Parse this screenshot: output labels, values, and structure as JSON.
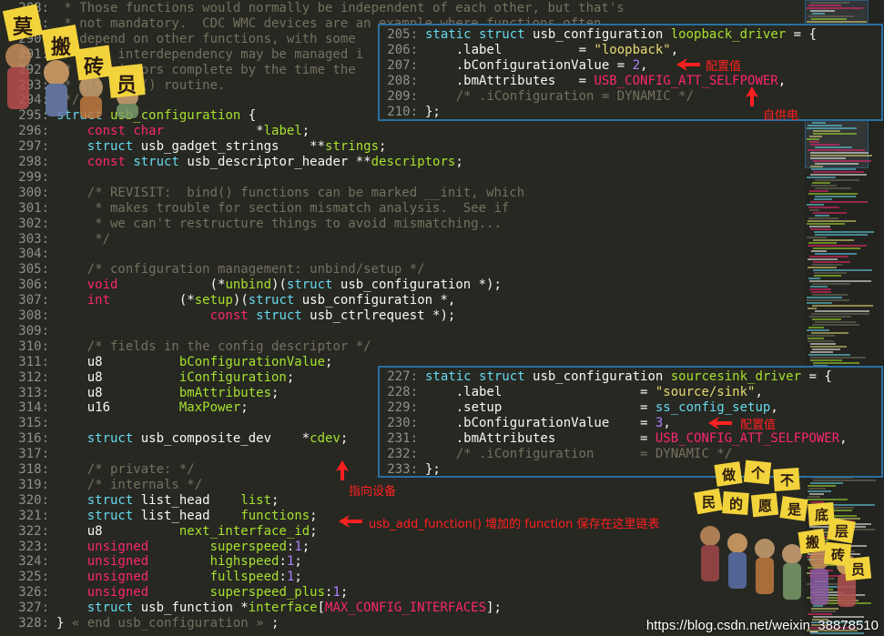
{
  "editor": {
    "lines": [
      {
        "no": "288:",
        "segs": [
          {
            "c": "cm",
            "t": " * Those functions would normally be independent of each other, but that's"
          }
        ]
      },
      {
        "no": "289:",
        "segs": [
          {
            "c": "cm",
            "t": " * not mandatory.  CDC WMC devices are an example where functions often"
          }
        ]
      },
      {
        "no": "290:",
        "segs": [
          {
            "c": "cm",
            "t": " * depend on other functions, with some"
          }
        ]
      },
      {
        "no": "291:",
        "segs": [
          {
            "c": "cm",
            "t": " * such interdependency may be managed i"
          }
        ]
      },
      {
        "no": "292:",
        "segs": [
          {
            "c": "cm",
            "t": " * descriptors complete by the time the"
          }
        ]
      },
      {
        "no": "293:",
        "segs": [
          {
            "c": "cm",
            "t": " * its bind() routine."
          }
        ]
      },
      {
        "no": "294:",
        "segs": [
          {
            "c": "cm",
            "t": " */"
          }
        ]
      },
      {
        "no": "295:",
        "segs": [
          {
            "c": "ty",
            "t": "struct"
          },
          {
            "c": "tx",
            "t": " "
          },
          {
            "c": "id",
            "t": "usb_configuration"
          },
          {
            "c": "tx",
            "t": " {"
          }
        ]
      },
      {
        "no": "296:",
        "segs": [
          {
            "c": "tx",
            "t": "    "
          },
          {
            "c": "kw",
            "t": "const"
          },
          {
            "c": "tx",
            "t": " "
          },
          {
            "c": "kw",
            "t": "char"
          },
          {
            "c": "tx",
            "t": "            *"
          },
          {
            "c": "id",
            "t": "label"
          },
          {
            "c": "tx",
            "t": ";"
          }
        ]
      },
      {
        "no": "297:",
        "segs": [
          {
            "c": "tx",
            "t": "    "
          },
          {
            "c": "ty",
            "t": "struct"
          },
          {
            "c": "tx",
            "t": " usb_gadget_strings    **"
          },
          {
            "c": "id",
            "t": "strings"
          },
          {
            "c": "tx",
            "t": ";"
          }
        ]
      },
      {
        "no": "298:",
        "segs": [
          {
            "c": "tx",
            "t": "    "
          },
          {
            "c": "kw",
            "t": "const"
          },
          {
            "c": "tx",
            "t": " "
          },
          {
            "c": "ty",
            "t": "struct"
          },
          {
            "c": "tx",
            "t": " usb_descriptor_header **"
          },
          {
            "c": "id",
            "t": "descriptors"
          },
          {
            "c": "tx",
            "t": ";"
          }
        ]
      },
      {
        "no": "299:",
        "segs": []
      },
      {
        "no": "300:",
        "segs": [
          {
            "c": "tx",
            "t": "    "
          },
          {
            "c": "cm",
            "t": "/* REVISIT:  bind() functions can be marked __init, which"
          }
        ]
      },
      {
        "no": "301:",
        "segs": [
          {
            "c": "tx",
            "t": "    "
          },
          {
            "c": "cm",
            "t": " * makes trouble for section mismatch analysis.  See if"
          }
        ]
      },
      {
        "no": "302:",
        "segs": [
          {
            "c": "tx",
            "t": "    "
          },
          {
            "c": "cm",
            "t": " * we can't restructure things to avoid mismatching..."
          }
        ]
      },
      {
        "no": "303:",
        "segs": [
          {
            "c": "tx",
            "t": "    "
          },
          {
            "c": "cm",
            "t": " */"
          }
        ]
      },
      {
        "no": "304:",
        "segs": []
      },
      {
        "no": "305:",
        "segs": [
          {
            "c": "tx",
            "t": "    "
          },
          {
            "c": "cm",
            "t": "/* configuration management: unbind/setup */"
          }
        ]
      },
      {
        "no": "306:",
        "segs": [
          {
            "c": "tx",
            "t": "    "
          },
          {
            "c": "kw",
            "t": "void"
          },
          {
            "c": "tx",
            "t": "            (*"
          },
          {
            "c": "id",
            "t": "unbind"
          },
          {
            "c": "tx",
            "t": ")("
          },
          {
            "c": "ty",
            "t": "struct"
          },
          {
            "c": "tx",
            "t": " usb_configuration *);"
          }
        ]
      },
      {
        "no": "307:",
        "segs": [
          {
            "c": "tx",
            "t": "    "
          },
          {
            "c": "kw",
            "t": "int"
          },
          {
            "c": "tx",
            "t": "         (*"
          },
          {
            "c": "id",
            "t": "setup"
          },
          {
            "c": "tx",
            "t": ")("
          },
          {
            "c": "ty",
            "t": "struct"
          },
          {
            "c": "tx",
            "t": " usb_configuration *,"
          }
        ]
      },
      {
        "no": "308:",
        "segs": [
          {
            "c": "tx",
            "t": "                    "
          },
          {
            "c": "kw",
            "t": "const"
          },
          {
            "c": "tx",
            "t": " "
          },
          {
            "c": "ty",
            "t": "struct"
          },
          {
            "c": "tx",
            "t": " usb_ctrlrequest *);"
          }
        ]
      },
      {
        "no": "309:",
        "segs": []
      },
      {
        "no": "310:",
        "segs": [
          {
            "c": "tx",
            "t": "    "
          },
          {
            "c": "cm",
            "t": "/* fields in the config descriptor */"
          }
        ]
      },
      {
        "no": "311:",
        "segs": [
          {
            "c": "tx",
            "t": "    u8          "
          },
          {
            "c": "id",
            "t": "bConfigurationValue"
          },
          {
            "c": "tx",
            "t": ";"
          }
        ]
      },
      {
        "no": "312:",
        "segs": [
          {
            "c": "tx",
            "t": "    u8          "
          },
          {
            "c": "id",
            "t": "iConfiguration"
          },
          {
            "c": "tx",
            "t": ";"
          }
        ]
      },
      {
        "no": "313:",
        "segs": [
          {
            "c": "tx",
            "t": "    u8          "
          },
          {
            "c": "id",
            "t": "bmAttributes"
          },
          {
            "c": "tx",
            "t": ";"
          }
        ]
      },
      {
        "no": "314:",
        "segs": [
          {
            "c": "tx",
            "t": "    u16         "
          },
          {
            "c": "id",
            "t": "MaxPower"
          },
          {
            "c": "tx",
            "t": ";"
          }
        ]
      },
      {
        "no": "315:",
        "segs": []
      },
      {
        "no": "316:",
        "segs": [
          {
            "c": "tx",
            "t": "    "
          },
          {
            "c": "ty",
            "t": "struct"
          },
          {
            "c": "tx",
            "t": " usb_composite_dev    *"
          },
          {
            "c": "id",
            "t": "cdev"
          },
          {
            "c": "tx",
            "t": ";"
          }
        ]
      },
      {
        "no": "317:",
        "segs": []
      },
      {
        "no": "318:",
        "segs": [
          {
            "c": "tx",
            "t": "    "
          },
          {
            "c": "cm",
            "t": "/* private: */"
          }
        ]
      },
      {
        "no": "319:",
        "segs": [
          {
            "c": "tx",
            "t": "    "
          },
          {
            "c": "cm",
            "t": "/* internals */"
          }
        ]
      },
      {
        "no": "320:",
        "segs": [
          {
            "c": "tx",
            "t": "    "
          },
          {
            "c": "ty",
            "t": "struct"
          },
          {
            "c": "tx",
            "t": " list_head    "
          },
          {
            "c": "id",
            "t": "list"
          },
          {
            "c": "tx",
            "t": ";"
          }
        ]
      },
      {
        "no": "321:",
        "segs": [
          {
            "c": "tx",
            "t": "    "
          },
          {
            "c": "ty",
            "t": "struct"
          },
          {
            "c": "tx",
            "t": " list_head    "
          },
          {
            "c": "id",
            "t": "functions"
          },
          {
            "c": "tx",
            "t": ";"
          }
        ]
      },
      {
        "no": "322:",
        "segs": [
          {
            "c": "tx",
            "t": "    u8          "
          },
          {
            "c": "id",
            "t": "next_interface_id"
          },
          {
            "c": "tx",
            "t": ";"
          }
        ]
      },
      {
        "no": "323:",
        "segs": [
          {
            "c": "tx",
            "t": "    "
          },
          {
            "c": "kw",
            "t": "unsigned"
          },
          {
            "c": "tx",
            "t": "        "
          },
          {
            "c": "id",
            "t": "superspeed"
          },
          {
            "c": "tx",
            "t": ":"
          },
          {
            "c": "nm",
            "t": "1"
          },
          {
            "c": "tx",
            "t": ";"
          }
        ]
      },
      {
        "no": "324:",
        "segs": [
          {
            "c": "tx",
            "t": "    "
          },
          {
            "c": "kw",
            "t": "unsigned"
          },
          {
            "c": "tx",
            "t": "        "
          },
          {
            "c": "id",
            "t": "highspeed"
          },
          {
            "c": "tx",
            "t": ":"
          },
          {
            "c": "nm",
            "t": "1"
          },
          {
            "c": "tx",
            "t": ";"
          }
        ]
      },
      {
        "no": "325:",
        "segs": [
          {
            "c": "tx",
            "t": "    "
          },
          {
            "c": "kw",
            "t": "unsigned"
          },
          {
            "c": "tx",
            "t": "        "
          },
          {
            "c": "id",
            "t": "fullspeed"
          },
          {
            "c": "tx",
            "t": ":"
          },
          {
            "c": "nm",
            "t": "1"
          },
          {
            "c": "tx",
            "t": ";"
          }
        ]
      },
      {
        "no": "326:",
        "segs": [
          {
            "c": "tx",
            "t": "    "
          },
          {
            "c": "kw",
            "t": "unsigned"
          },
          {
            "c": "tx",
            "t": "        "
          },
          {
            "c": "id",
            "t": "superspeed_plus"
          },
          {
            "c": "tx",
            "t": ":"
          },
          {
            "c": "nm",
            "t": "1"
          },
          {
            "c": "tx",
            "t": ";"
          }
        ]
      },
      {
        "no": "327:",
        "segs": [
          {
            "c": "tx",
            "t": "    "
          },
          {
            "c": "ty",
            "t": "struct"
          },
          {
            "c": "tx",
            "t": " usb_function *"
          },
          {
            "c": "id",
            "t": "interface"
          },
          {
            "c": "tx",
            "t": "["
          },
          {
            "c": "kw",
            "t": "MAX_CONFIG_INTERFACES"
          },
          {
            "c": "tx",
            "t": "];"
          }
        ]
      },
      {
        "no": "328:",
        "segs": [
          {
            "c": "tx",
            "t": "} "
          },
          {
            "c": "cm",
            "t": "« end usb_configuration »"
          },
          {
            "c": "tx",
            "t": " ;"
          }
        ]
      }
    ]
  },
  "popup1": {
    "lines": [
      {
        "no": "205:",
        "segs": [
          {
            "c": "ty",
            "t": "static"
          },
          {
            "c": "tx",
            "t": " "
          },
          {
            "c": "ty",
            "t": "struct"
          },
          {
            "c": "tx",
            "t": " usb_configuration "
          },
          {
            "c": "id",
            "t": "loopback_driver"
          },
          {
            "c": "tx",
            "t": " = {"
          }
        ]
      },
      {
        "no": "206:",
        "segs": [
          {
            "c": "tx",
            "t": "    .label          = "
          },
          {
            "c": "st",
            "t": "\"loopback\""
          },
          {
            "c": "tx",
            "t": ","
          }
        ]
      },
      {
        "no": "207:",
        "segs": [
          {
            "c": "tx",
            "t": "    .bConfigurationValue = "
          },
          {
            "c": "nm",
            "t": "2"
          },
          {
            "c": "tx",
            "t": ","
          }
        ]
      },
      {
        "no": "208:",
        "segs": [
          {
            "c": "tx",
            "t": "    .bmAttributes   = "
          },
          {
            "c": "kw",
            "t": "USB_CONFIG_ATT_SELFPOWER"
          },
          {
            "c": "tx",
            "t": ","
          }
        ]
      },
      {
        "no": "209:",
        "segs": [
          {
            "c": "tx",
            "t": "    "
          },
          {
            "c": "cm",
            "t": "/* .iConfiguration = DYNAMIC */"
          }
        ]
      },
      {
        "no": "210:",
        "segs": [
          {
            "c": "tx",
            "t": "};"
          }
        ]
      }
    ]
  },
  "popup2": {
    "lines": [
      {
        "no": "227:",
        "segs": [
          {
            "c": "ty",
            "t": "static"
          },
          {
            "c": "tx",
            "t": " "
          },
          {
            "c": "ty",
            "t": "struct"
          },
          {
            "c": "tx",
            "t": " usb_configuration "
          },
          {
            "c": "id",
            "t": "sourcesink_driver"
          },
          {
            "c": "tx",
            "t": " = {"
          }
        ]
      },
      {
        "no": "228:",
        "segs": [
          {
            "c": "tx",
            "t": "    .label                  = "
          },
          {
            "c": "st",
            "t": "\"source/sink\""
          },
          {
            "c": "tx",
            "t": ","
          }
        ]
      },
      {
        "no": "229:",
        "segs": [
          {
            "c": "tx",
            "t": "    .setup                  = "
          },
          {
            "c": "ty",
            "t": "ss_config_setup"
          },
          {
            "c": "tx",
            "t": ","
          }
        ]
      },
      {
        "no": "230:",
        "segs": [
          {
            "c": "tx",
            "t": "    .bConfigurationValue    = "
          },
          {
            "c": "nm",
            "t": "3"
          },
          {
            "c": "tx",
            "t": ","
          }
        ]
      },
      {
        "no": "231:",
        "segs": [
          {
            "c": "tx",
            "t": "    .bmAttributes           = "
          },
          {
            "c": "kw",
            "t": "USB_CONFIG_ATT_SELFPOWER"
          },
          {
            "c": "tx",
            "t": ","
          }
        ]
      },
      {
        "no": "232:",
        "segs": [
          {
            "c": "tx",
            "t": "    "
          },
          {
            "c": "cm",
            "t": "/* .iConfiguration      = DYNAMIC */"
          }
        ]
      },
      {
        "no": "233:",
        "segs": [
          {
            "c": "tx",
            "t": "};"
          }
        ]
      }
    ]
  },
  "annotations": {
    "config_value_1": "配置值",
    "self_powered": "自供电",
    "config_value_2": "配置值",
    "points_to_device": "指向设备",
    "functions_note": "usb_add_function() 增加的 function 保存在这里链表"
  },
  "sticker_top": [
    "莫",
    "搬",
    "砖",
    "员"
  ],
  "sticker_bottom": [
    "做",
    "个",
    "不",
    "民",
    "的",
    "愿",
    "是",
    "底",
    "层",
    "搬",
    "砖",
    "员"
  ],
  "watermark": "https://blog.csdn.net/weixin_38878510",
  "colors": {
    "background": "#272822",
    "keyword": "#f92672",
    "type": "#66d9ef",
    "identifier": "#a6e22e",
    "comment": "#75715e",
    "number": "#ae81ff",
    "string": "#e6db74",
    "annotation": "#ff2020",
    "popup_border": "#2b6fa0"
  }
}
